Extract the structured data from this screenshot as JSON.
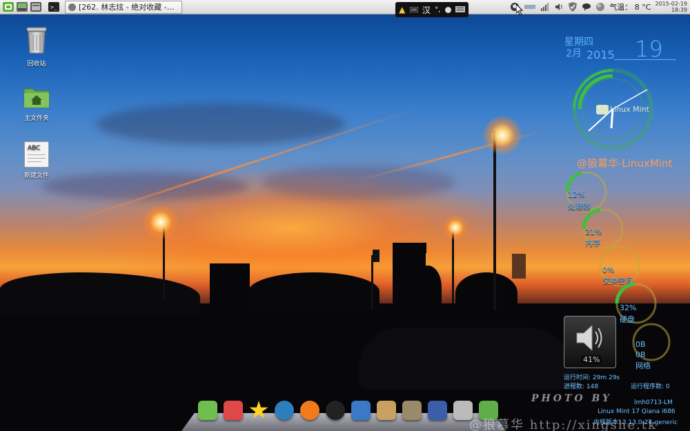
{
  "panel": {
    "task_title": "[262. 林志炫 - 绝对收藏 -…",
    "weather": "气温： 8 °C",
    "clock_date": "2015-02-19",
    "clock_time": "18:39"
  },
  "ime": {
    "mode": "汉",
    "punct": "°,"
  },
  "desktop_icons": [
    {
      "label": "回收站",
      "icon": "trash-icon"
    },
    {
      "label": "主文件夹",
      "icon": "home-folder-icon"
    },
    {
      "label": "新建文件",
      "icon": "text-file-icon",
      "icon_text": "ABC"
    }
  ],
  "date_widget": {
    "weekday": "星期四",
    "month": "2月",
    "year": "2015",
    "day": "19"
  },
  "clock_widget": {
    "logo_text": "Linux Mint"
  },
  "signature": "@狼幕华-LinuxMint",
  "rings": [
    {
      "name": "cpu",
      "pct": "12%",
      "label": "处理器",
      "fill": 0.12,
      "color": "#3fbf3f"
    },
    {
      "name": "memory",
      "pct": "21%",
      "label": "内存",
      "fill": 0.21,
      "color": "#3fbf3f"
    },
    {
      "name": "swap",
      "pct": "0%",
      "label": "交换空间",
      "fill": 0.0,
      "color": "#c7a43a"
    },
    {
      "name": "disk",
      "pct": "32%",
      "label": "硬盘",
      "fill": 0.32,
      "color": "#3fbf3f"
    },
    {
      "name": "network",
      "down": "0B",
      "up": "0B",
      "label": "网络",
      "fill": 0.0,
      "color": "#c7a43a"
    }
  ],
  "volume": {
    "pct": "41%"
  },
  "system_info": {
    "uptime": "运行时间: 29m 29s",
    "processes": "进程数: 148",
    "running": "运行程序数: 0",
    "hostname": "lmh0713-LM",
    "distro": "Linux Mint 17 Qiana  i686",
    "kernel": "内核版本: 3.13.0-24-generic"
  },
  "photo_by": "PHOTO BY",
  "watermark": "@狼慕华  http://xingshe.tk",
  "dock": [
    {
      "icon": "desktop-icon",
      "color": "#6fbf4f"
    },
    {
      "icon": "mail-icon",
      "color": "#e04848"
    },
    {
      "icon": "star-icon",
      "color": "#ffd21f"
    },
    {
      "icon": "timeshift-icon",
      "color": "#2c7fbf"
    },
    {
      "icon": "firefox-icon",
      "color": "#f07a1c"
    },
    {
      "icon": "amazon-icon",
      "color": "#222222"
    },
    {
      "icon": "html5-icon",
      "color": "#3a78c8"
    },
    {
      "icon": "package-icon",
      "color": "#c8a060"
    },
    {
      "icon": "gimp-icon",
      "color": "#9a8a6a"
    },
    {
      "icon": "preview-icon",
      "color": "#3a5fa8"
    },
    {
      "icon": "mail-at-icon",
      "color": "#bbbbbb"
    },
    {
      "icon": "backup-icon",
      "color": "#5fae4a"
    }
  ]
}
